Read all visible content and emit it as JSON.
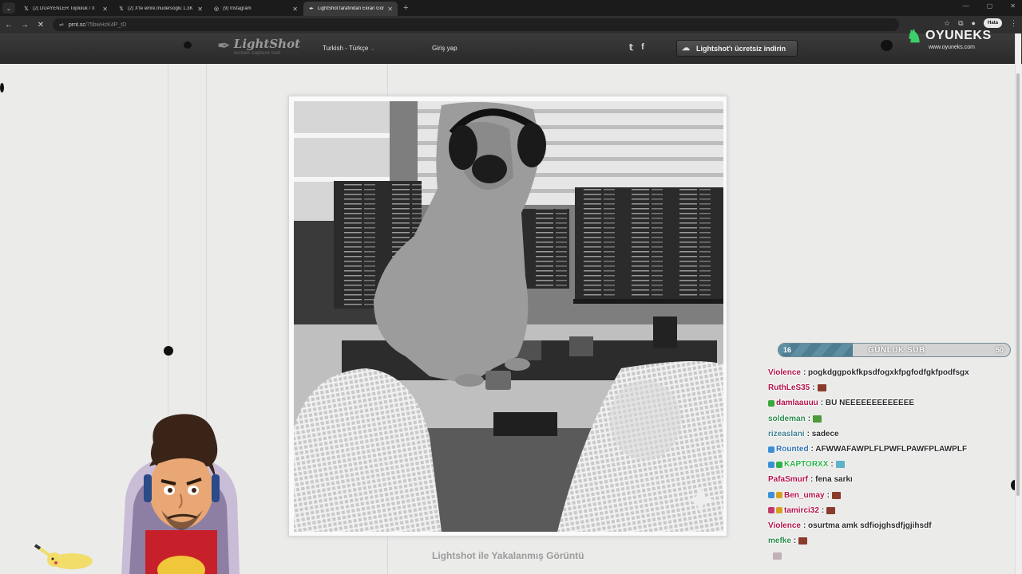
{
  "browser": {
    "tabs": [
      {
        "label": "(2) DUAYENLER Topluluk / X",
        "icon": "x-icon",
        "active": false
      },
      {
        "label": "(2) X'te emre.mudersoglu 1.3K",
        "icon": "x-icon",
        "active": false
      },
      {
        "label": "(9) Instagram",
        "icon": "instagram-icon",
        "active": false
      },
      {
        "label": "LightShot tarafından Ekran Gör",
        "icon": "lightshot-icon",
        "active": true
      }
    ],
    "url_domain": "prnt.sc",
    "url_path": "/75bwHzK4P_tD",
    "error_label": "Hata"
  },
  "header": {
    "logo_title": "LightShot",
    "logo_subtitle": "screen capture tool",
    "language": "Turkish - Türkçe",
    "login": "Giriş yap",
    "download": "Lightshot'ı ücretsiz indirin"
  },
  "overlay": {
    "brand": "OYUNEKS",
    "brand_url": "www.oyuneks.com",
    "sub_current": "16",
    "sub_label": "GÜNLUK SUB",
    "sub_goal": "50",
    "sub_fraction": 0.32
  },
  "chat": [
    {
      "user": "Violence",
      "user_color": "#b0124a",
      "msg": ": pogkdggpokfkpsdfogxkfpgfodfgkfpodfsgx",
      "badges": [],
      "emote": ""
    },
    {
      "user": "RuthLeS35",
      "user_color": "#b0124a",
      "msg": ":",
      "badges": [],
      "emote": "#8a3b2c"
    },
    {
      "user": "damlaauuu",
      "user_color": "#b0124a",
      "msg": ": BU NEEEEEEEEEEEEE",
      "badges": [
        "#3aa83a"
      ],
      "emote": ""
    },
    {
      "user": "soldeman",
      "user_color": "#2a8a4a",
      "msg": ":",
      "badges": [],
      "emote": "#4c9a3a"
    },
    {
      "user": "rizeaslani",
      "user_color": "#3f7f8f",
      "msg": ": sadece",
      "badges": [],
      "emote": ""
    },
    {
      "user": "Rounted",
      "user_color": "#2e6fb0",
      "msg": ": AFWWAFAWPLFLPWFLPAWFPLAWPLF",
      "badges": [
        "#3b8fd6"
      ],
      "emote": ""
    },
    {
      "user": "KAPTORXX",
      "user_color": "#2fb34a",
      "msg": ":",
      "badges": [
        "#3b8fd6",
        "#2fb34a"
      ],
      "emote": "#5fb3c8"
    },
    {
      "user": "PafaSmurf",
      "user_color": "#b0124a",
      "msg": ": fena sarkı",
      "badges": [],
      "emote": ""
    },
    {
      "user": "Ben_umay",
      "user_color": "#b0124a",
      "msg": ":",
      "badges": [
        "#3b8fd6",
        "#d9a020"
      ],
      "emote": "#8a3b2c"
    },
    {
      "user": "tamirci32",
      "user_color": "#b0124a",
      "msg": ":",
      "badges": [
        "#c43a6a",
        "#d9a020"
      ],
      "emote": "#8a3b2c"
    },
    {
      "user": "Violence",
      "user_color": "#b0124a",
      "msg": ": osurtma amk sdfiojghsdfjgjihsdf",
      "badges": [],
      "emote": ""
    },
    {
      "user": "mefke",
      "user_color": "#2a8a4a",
      "msg": ":",
      "badges": [],
      "emote": "#8a3b2c"
    },
    {
      "user": "",
      "user_color": "#666",
      "msg": "",
      "badges": [],
      "emote": "#c0b0b8"
    }
  ],
  "caption": "Lightshot ile Yakalanmış Görüntü"
}
